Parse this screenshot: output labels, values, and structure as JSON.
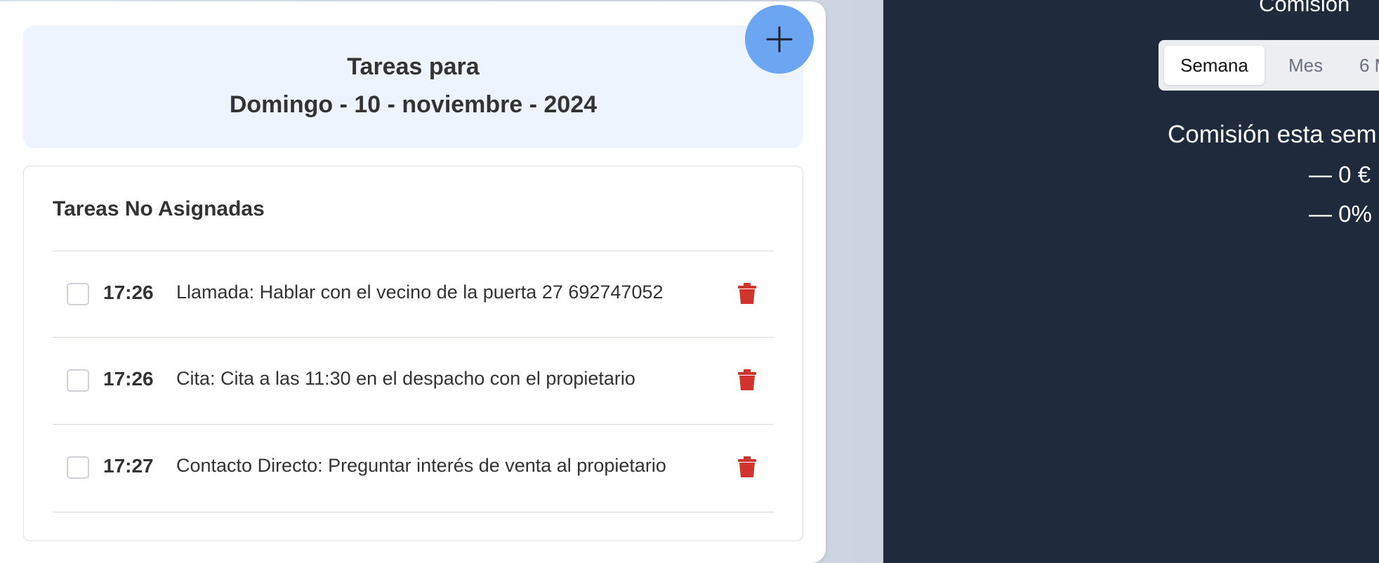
{
  "tasks_panel": {
    "header": {
      "line1": "Tareas para",
      "line2": "Domingo - 10 - noviembre - 2024"
    },
    "add_button": {
      "icon": "plus-icon"
    },
    "section_title": "Tareas No Asignadas",
    "tasks": [
      {
        "time": "17:26",
        "text": "Llamada: Hablar con el vecino de la puerta 27 692747052"
      },
      {
        "time": "17:26",
        "text": "Cita: Cita a las 11:30 en el despacho con el propietario"
      },
      {
        "time": "17:27",
        "text": "Contacto Directo: Preguntar interés de venta al propietario"
      }
    ]
  },
  "commission_panel": {
    "title_partial": "Comisión",
    "tabs": [
      "Semana",
      "Mes",
      "6 M"
    ],
    "active_tab": "Semana",
    "this_week_label": "Comisión esta sem",
    "amount": "— 0 €",
    "percent": "— 0%"
  },
  "colors": {
    "dark_panel": "#1f2a3c",
    "add_button": "#6ca6f2",
    "trash": "#d0342c",
    "header_bg": "#eef4fd"
  }
}
